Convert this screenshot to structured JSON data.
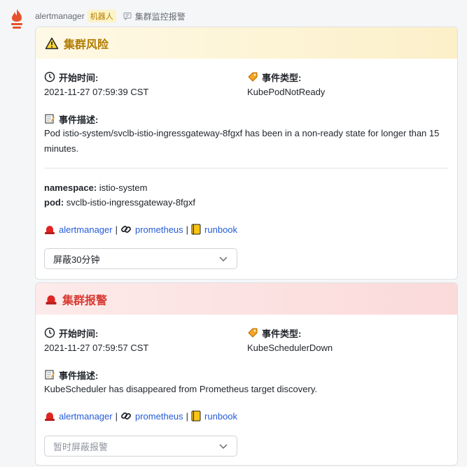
{
  "message": {
    "sender": "alertmanager",
    "bot_badge": "机器人",
    "group_name": "集群监控报警"
  },
  "cards": [
    {
      "title": "集群风险",
      "start_label": "开始时间:",
      "start_value": "2021-11-27 07:59:39 CST",
      "type_label": "事件类型:",
      "type_value": "KubePodNotReady",
      "desc_label": "事件描述:",
      "desc_value": "Pod istio-system/svclb-istio-ingressgateway-8fgxf has been in a non-ready state for longer than 15 minutes.",
      "namespace_key": "namespace:",
      "namespace_value": "istio-system",
      "pod_key": "pod:",
      "pod_value": "svclb-istio-ingressgateway-8fgxf",
      "link_alertmanager": "alertmanager",
      "link_prometheus": "prometheus",
      "link_runbook": "runbook",
      "select_value": "屏蔽30分钟"
    },
    {
      "title": "集群报警",
      "start_label": "开始时间:",
      "start_value": "2021-11-27 07:59:57 CST",
      "type_label": "事件类型:",
      "type_value": "KubeSchedulerDown",
      "desc_label": "事件描述:",
      "desc_value": "KubeScheduler has disappeared from Prometheus target discovery.",
      "link_alertmanager": "alertmanager",
      "link_prometheus": "prometheus",
      "link_runbook": "runbook",
      "select_placeholder": "暂时屏蔽报警"
    }
  ],
  "separator": "|",
  "colors": {
    "warning_title": "#b37b00",
    "alert_title": "#d83931",
    "link": "#245bdb",
    "placeholder": "#8f959e"
  }
}
